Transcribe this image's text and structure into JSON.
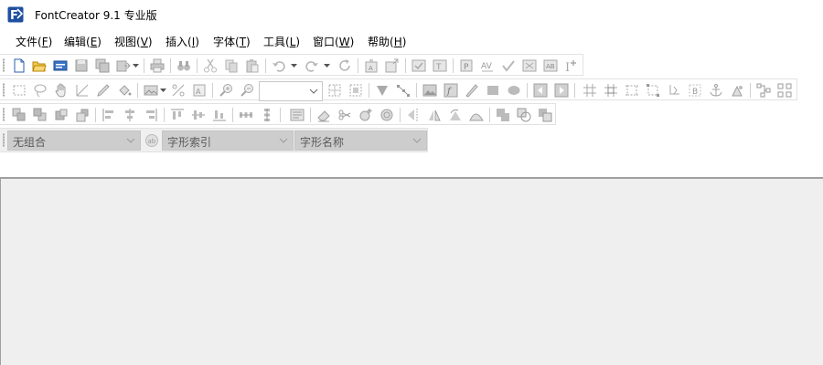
{
  "window": {
    "title": "FontCreator 9.1 专业版",
    "app_icon": "fontcreator-app-icon"
  },
  "menu": [
    {
      "label": "文件(",
      "key": "F",
      "suffix": ")"
    },
    {
      "label": "编辑(",
      "key": "E",
      "suffix": ")"
    },
    {
      "label": "视图(",
      "key": "V",
      "suffix": ")"
    },
    {
      "label": "插入(",
      "key": "I",
      "suffix": ")"
    },
    {
      "label": "字体(",
      "key": "T",
      "suffix": ")"
    },
    {
      "label": "工具(",
      "key": "L",
      "suffix": ")"
    },
    {
      "label": "窗口(",
      "key": "W",
      "suffix": ")"
    },
    {
      "label": "帮助(",
      "key": "H",
      "suffix": ")"
    }
  ],
  "toolbar": {
    "zoom_value": "",
    "glyph_group": "无组合",
    "glyph_index": "字形索引",
    "glyph_name": "字形名称"
  },
  "colors": {
    "icon_enabled": "#2a5db0",
    "icon_disabled": "#b8b8b8",
    "workspace": "#efefef"
  }
}
